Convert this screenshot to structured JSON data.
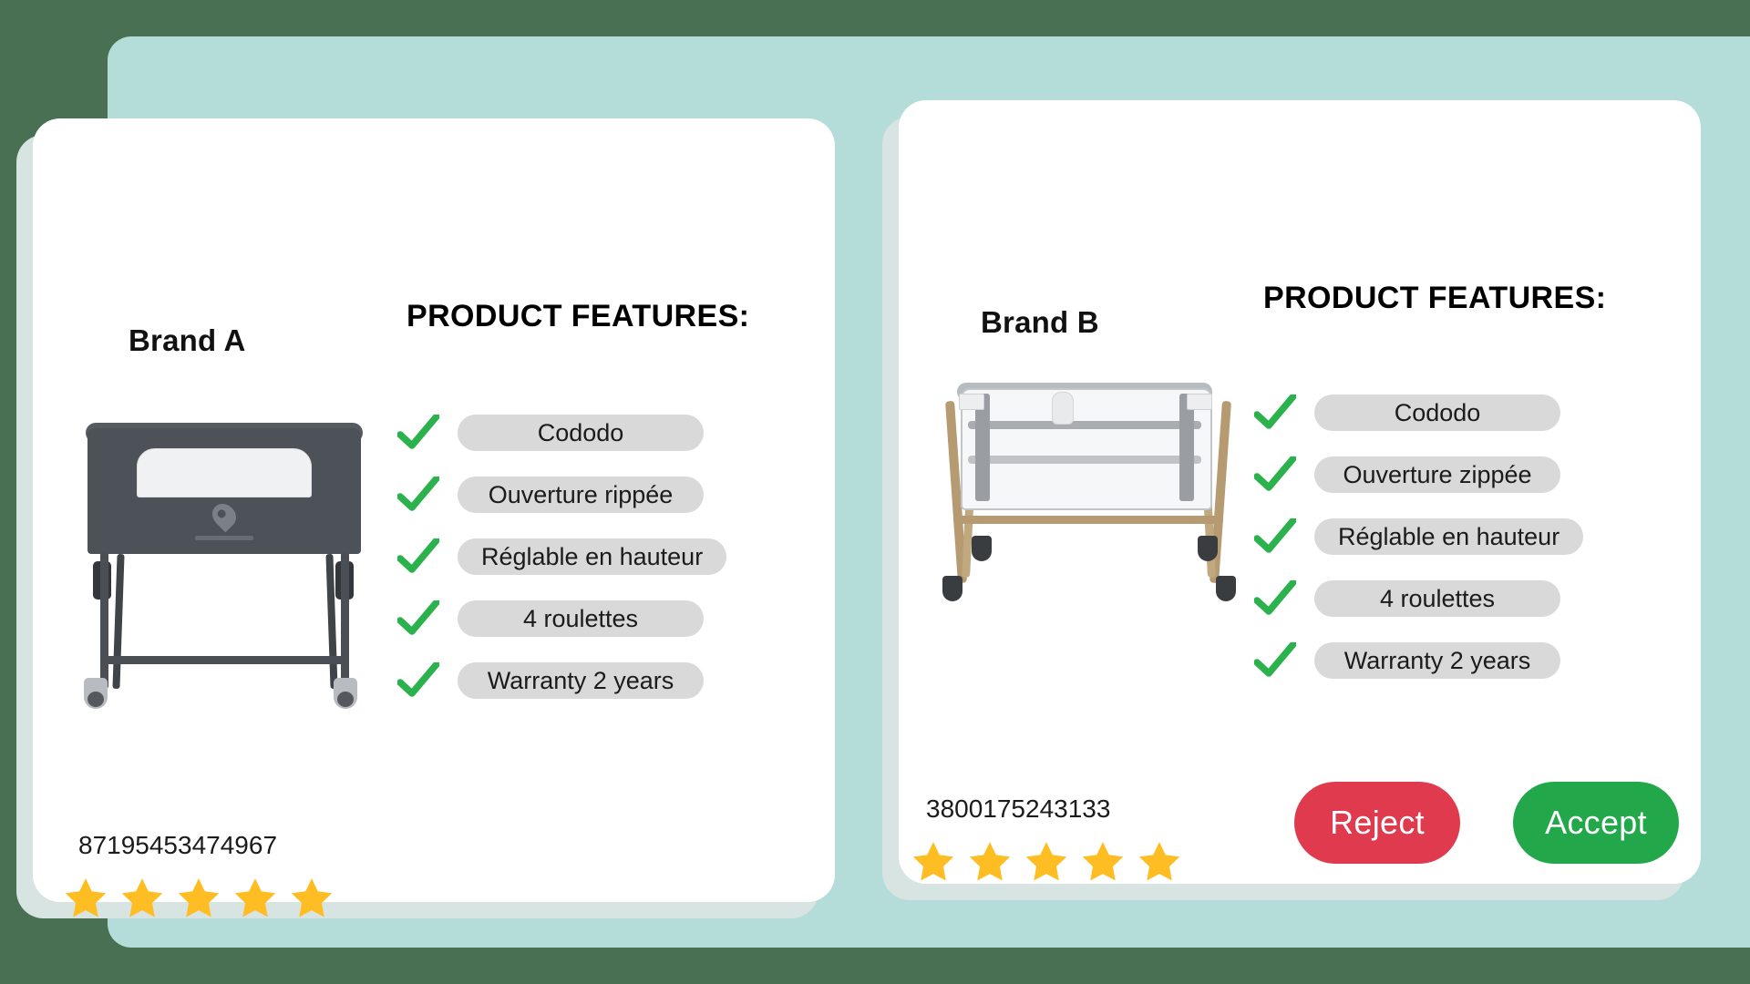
{
  "theme": {
    "page_background": "#4a7054",
    "panel_background": "#b4dcd8",
    "card_background": "#ffffff",
    "pill_background": "#d9d9d9",
    "check_color": "#2bb24c",
    "star_color": "#febd22",
    "reject_color": "#e03a4e",
    "accept_color": "#22a84a"
  },
  "products": [
    {
      "brand": "Brand A",
      "features_heading": "PRODUCT FEATURES:",
      "product_image": "dark-grey-bedside-crib",
      "features": [
        {
          "label": "Cododo",
          "icon": "check-icon",
          "included": true
        },
        {
          "label": "Ouverture rippée",
          "icon": "check-icon",
          "included": true
        },
        {
          "label": "Réglable en hauteur",
          "icon": "check-icon",
          "included": true
        },
        {
          "label": "4 roulettes",
          "icon": "check-icon",
          "included": true
        },
        {
          "label": "Warranty 2 years",
          "icon": "check-icon",
          "included": true
        }
      ],
      "product_code": "87195453474967",
      "rating": 5,
      "rating_max": 5
    },
    {
      "brand": "Brand B",
      "features_heading": "PRODUCT FEATURES:",
      "product_image": "light-grey-bedside-crib-with-tan-legs",
      "features": [
        {
          "label": "Cododo",
          "icon": "check-icon",
          "included": true
        },
        {
          "label": "Ouverture zippée",
          "icon": "check-icon",
          "included": true
        },
        {
          "label": "Réglable en hauteur",
          "icon": "check-icon",
          "included": true
        },
        {
          "label": "4 roulettes",
          "icon": "check-icon",
          "included": true
        },
        {
          "label": "Warranty 2 years",
          "icon": "check-icon",
          "included": true
        }
      ],
      "product_code": "3800175243133",
      "rating": 5,
      "rating_max": 5
    }
  ],
  "actions": {
    "reject_label": "Reject",
    "accept_label": "Accept"
  }
}
